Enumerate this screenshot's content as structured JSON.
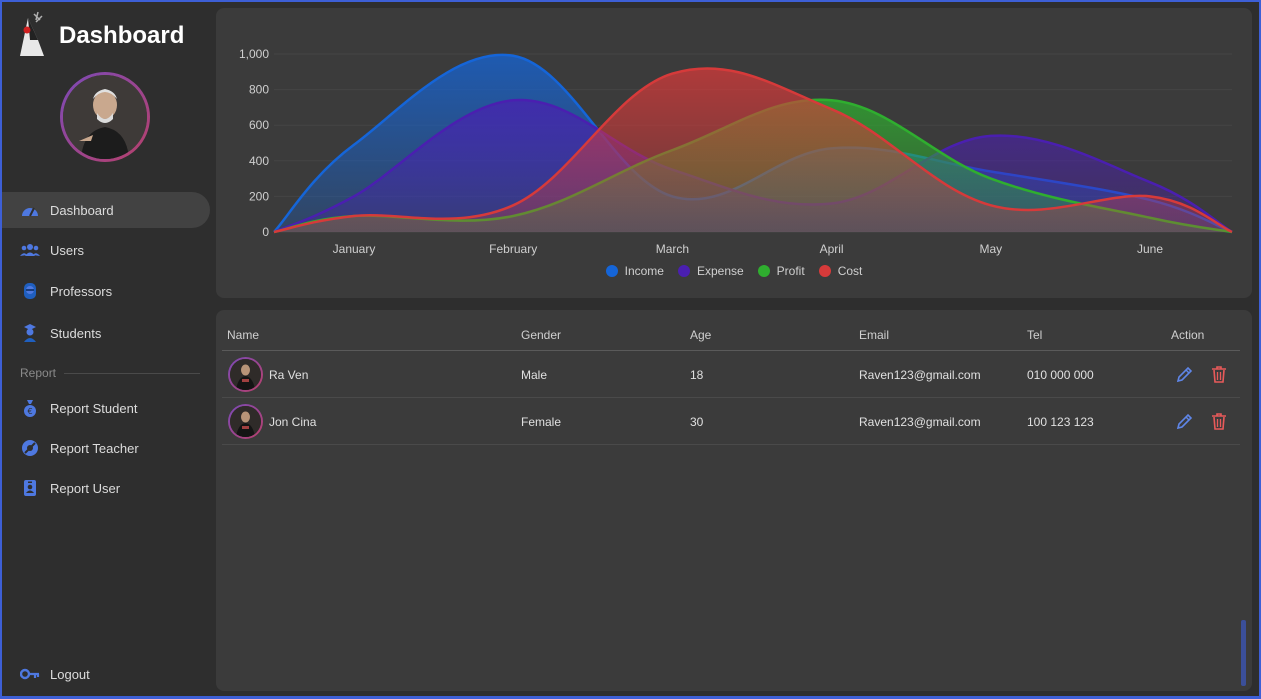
{
  "app": {
    "title": "Dashboard"
  },
  "sidebar": {
    "items": [
      {
        "label": "Dashboard",
        "icon": "gauge-icon",
        "active": true
      },
      {
        "label": "Users",
        "icon": "users-icon"
      },
      {
        "label": "Professors",
        "icon": "professor-icon"
      },
      {
        "label": "Students",
        "icon": "student-icon"
      }
    ],
    "section_label": "Report",
    "report_items": [
      {
        "label": "Report Student",
        "icon": "money-bag-icon"
      },
      {
        "label": "Report Teacher",
        "icon": "badge-icon"
      },
      {
        "label": "Report User",
        "icon": "id-card-icon"
      }
    ],
    "logout_label": "Logout"
  },
  "colors": {
    "accent": "#3d5fd6",
    "income": "#1565d8",
    "expense": "#4a1fb0",
    "profit": "#2fae2f",
    "cost": "#d63a3a"
  },
  "chart_data": {
    "type": "area",
    "categories": [
      "January",
      "February",
      "March",
      "April",
      "May",
      "June"
    ],
    "yticks": [
      "0",
      "200",
      "400",
      "600",
      "800",
      "1,000"
    ],
    "ylim": [
      0,
      1000
    ],
    "grid": true,
    "legend_position": "bottom",
    "series": [
      {
        "name": "Income",
        "values": [
          490,
          990,
          200,
          470,
          340,
          180
        ]
      },
      {
        "name": "Expense",
        "values": [
          200,
          740,
          350,
          160,
          540,
          280
        ]
      },
      {
        "name": "Profit",
        "values": [
          90,
          90,
          460,
          740,
          300,
          80
        ]
      },
      {
        "name": "Cost",
        "values": [
          90,
          150,
          890,
          690,
          150,
          200
        ]
      }
    ]
  },
  "table": {
    "headers": [
      "Name",
      "Gender",
      "Age",
      "Email",
      "Tel",
      "Action"
    ],
    "rows": [
      {
        "name": "Ra Ven",
        "gender": "Male",
        "age": "18",
        "email": "Raven123@gmail.com",
        "tel": "010 000 000"
      },
      {
        "name": "Jon Cina",
        "gender": "Female",
        "age": "30",
        "email": "Raven123@gmail.com",
        "tel": "100 123 123"
      }
    ]
  }
}
